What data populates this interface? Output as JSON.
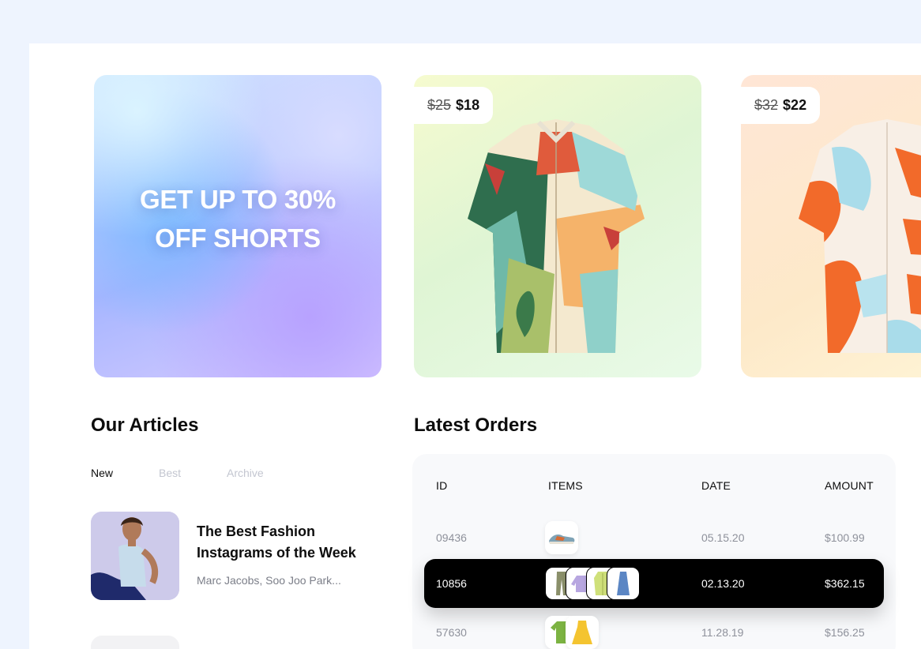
{
  "promo": {
    "line1": "GET UP TO 30%",
    "line2": "OFF SHORTS"
  },
  "products": [
    {
      "old_price": "$25",
      "new_price": "$18",
      "image": "tropical-shirt-icon"
    },
    {
      "old_price": "$32",
      "new_price": "$22",
      "image": "orange-shirt-icon"
    }
  ],
  "articles": {
    "title": "Our Articles",
    "tabs": [
      "New",
      "Best",
      "Archive"
    ],
    "active_tab": "New",
    "items": [
      {
        "title": "The Best Fashion Instagrams of the Week",
        "subtitle": "Marc Jacobs, Soo Joo Park..."
      }
    ]
  },
  "orders": {
    "title": "Latest Orders",
    "columns": [
      "ID",
      "ITEMS",
      "DATE",
      "AMOUNT"
    ],
    "rows": [
      {
        "id": "09436",
        "items": [
          "sneaker-icon"
        ],
        "date": "05.15.20",
        "amount": "$100.99"
      },
      {
        "id": "10856",
        "items": [
          "pants-icon",
          "sweater-icon",
          "jacket-icon",
          "skirt-icon"
        ],
        "date": "02.13.20",
        "amount": "$362.15",
        "selected": true
      },
      {
        "id": "57630",
        "items": [
          "tshirt-icon",
          "dress-icon"
        ],
        "date": "11.28.19",
        "amount": "$156.25"
      }
    ]
  },
  "colors": {
    "background": "#eef4fe",
    "panel": "#ffffff",
    "selected_row": "#000000",
    "muted_text": "#8e919b"
  }
}
